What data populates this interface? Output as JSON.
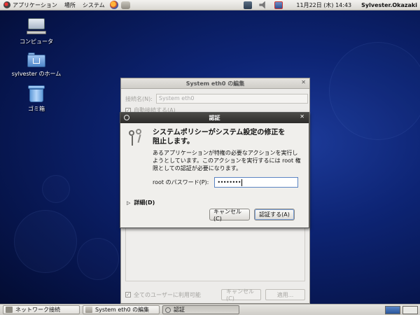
{
  "top_panel": {
    "menus": [
      "アプリケーション",
      "場所",
      "システム"
    ],
    "clock": "11月22日 (木) 14:43",
    "user": "Sylvester.Okazaki",
    "icons": [
      "redhat-logo-icon",
      "firefox-icon",
      "mail-icon",
      "network-icon",
      "volume-icon",
      "updates-icon"
    ]
  },
  "desktop": {
    "icons": [
      {
        "label": "コンピュータ",
        "icon": "computer-icon"
      },
      {
        "label": "sylvester のホーム",
        "icon": "home-folder-icon"
      },
      {
        "label": "ゴミ箱",
        "icon": "trash-icon"
      }
    ]
  },
  "edit_dialog": {
    "title": "System eth0 の編集",
    "close": "✕",
    "conn_name_label": "接続名(N):",
    "conn_name_value": "System eth0",
    "auto_connect_label": "自動接続する(A)",
    "all_users_label": "全てのユーザーに利用可能",
    "cancel": "キャンセル(C)",
    "apply": "適用..."
  },
  "auth_dialog": {
    "title": "認証",
    "close": "✕",
    "heading": "システムポリシーがシステム設定の修正を阻止します。",
    "description": "あるアプリケーションが特権の必要なアクションを実行しようとしています。このアクションを実行するには root 権限としての認証が必要になります。",
    "password_label": "root のパスワード(P):",
    "password_value": "••••••••",
    "details": "詳細(D)",
    "cancel": "キャンセル(C)",
    "authenticate": "認証する(A)"
  },
  "taskbar": {
    "tasks": [
      {
        "label": "ネットワーク接続",
        "active": false
      },
      {
        "label": "System eth0 の編集",
        "active": false
      },
      {
        "label": "認証",
        "active": true
      }
    ]
  },
  "colors": {
    "desktop_bg": "#0d2474",
    "panel_bg": "#d9d7d2",
    "auth_titlebar": "#2c2b29"
  }
}
